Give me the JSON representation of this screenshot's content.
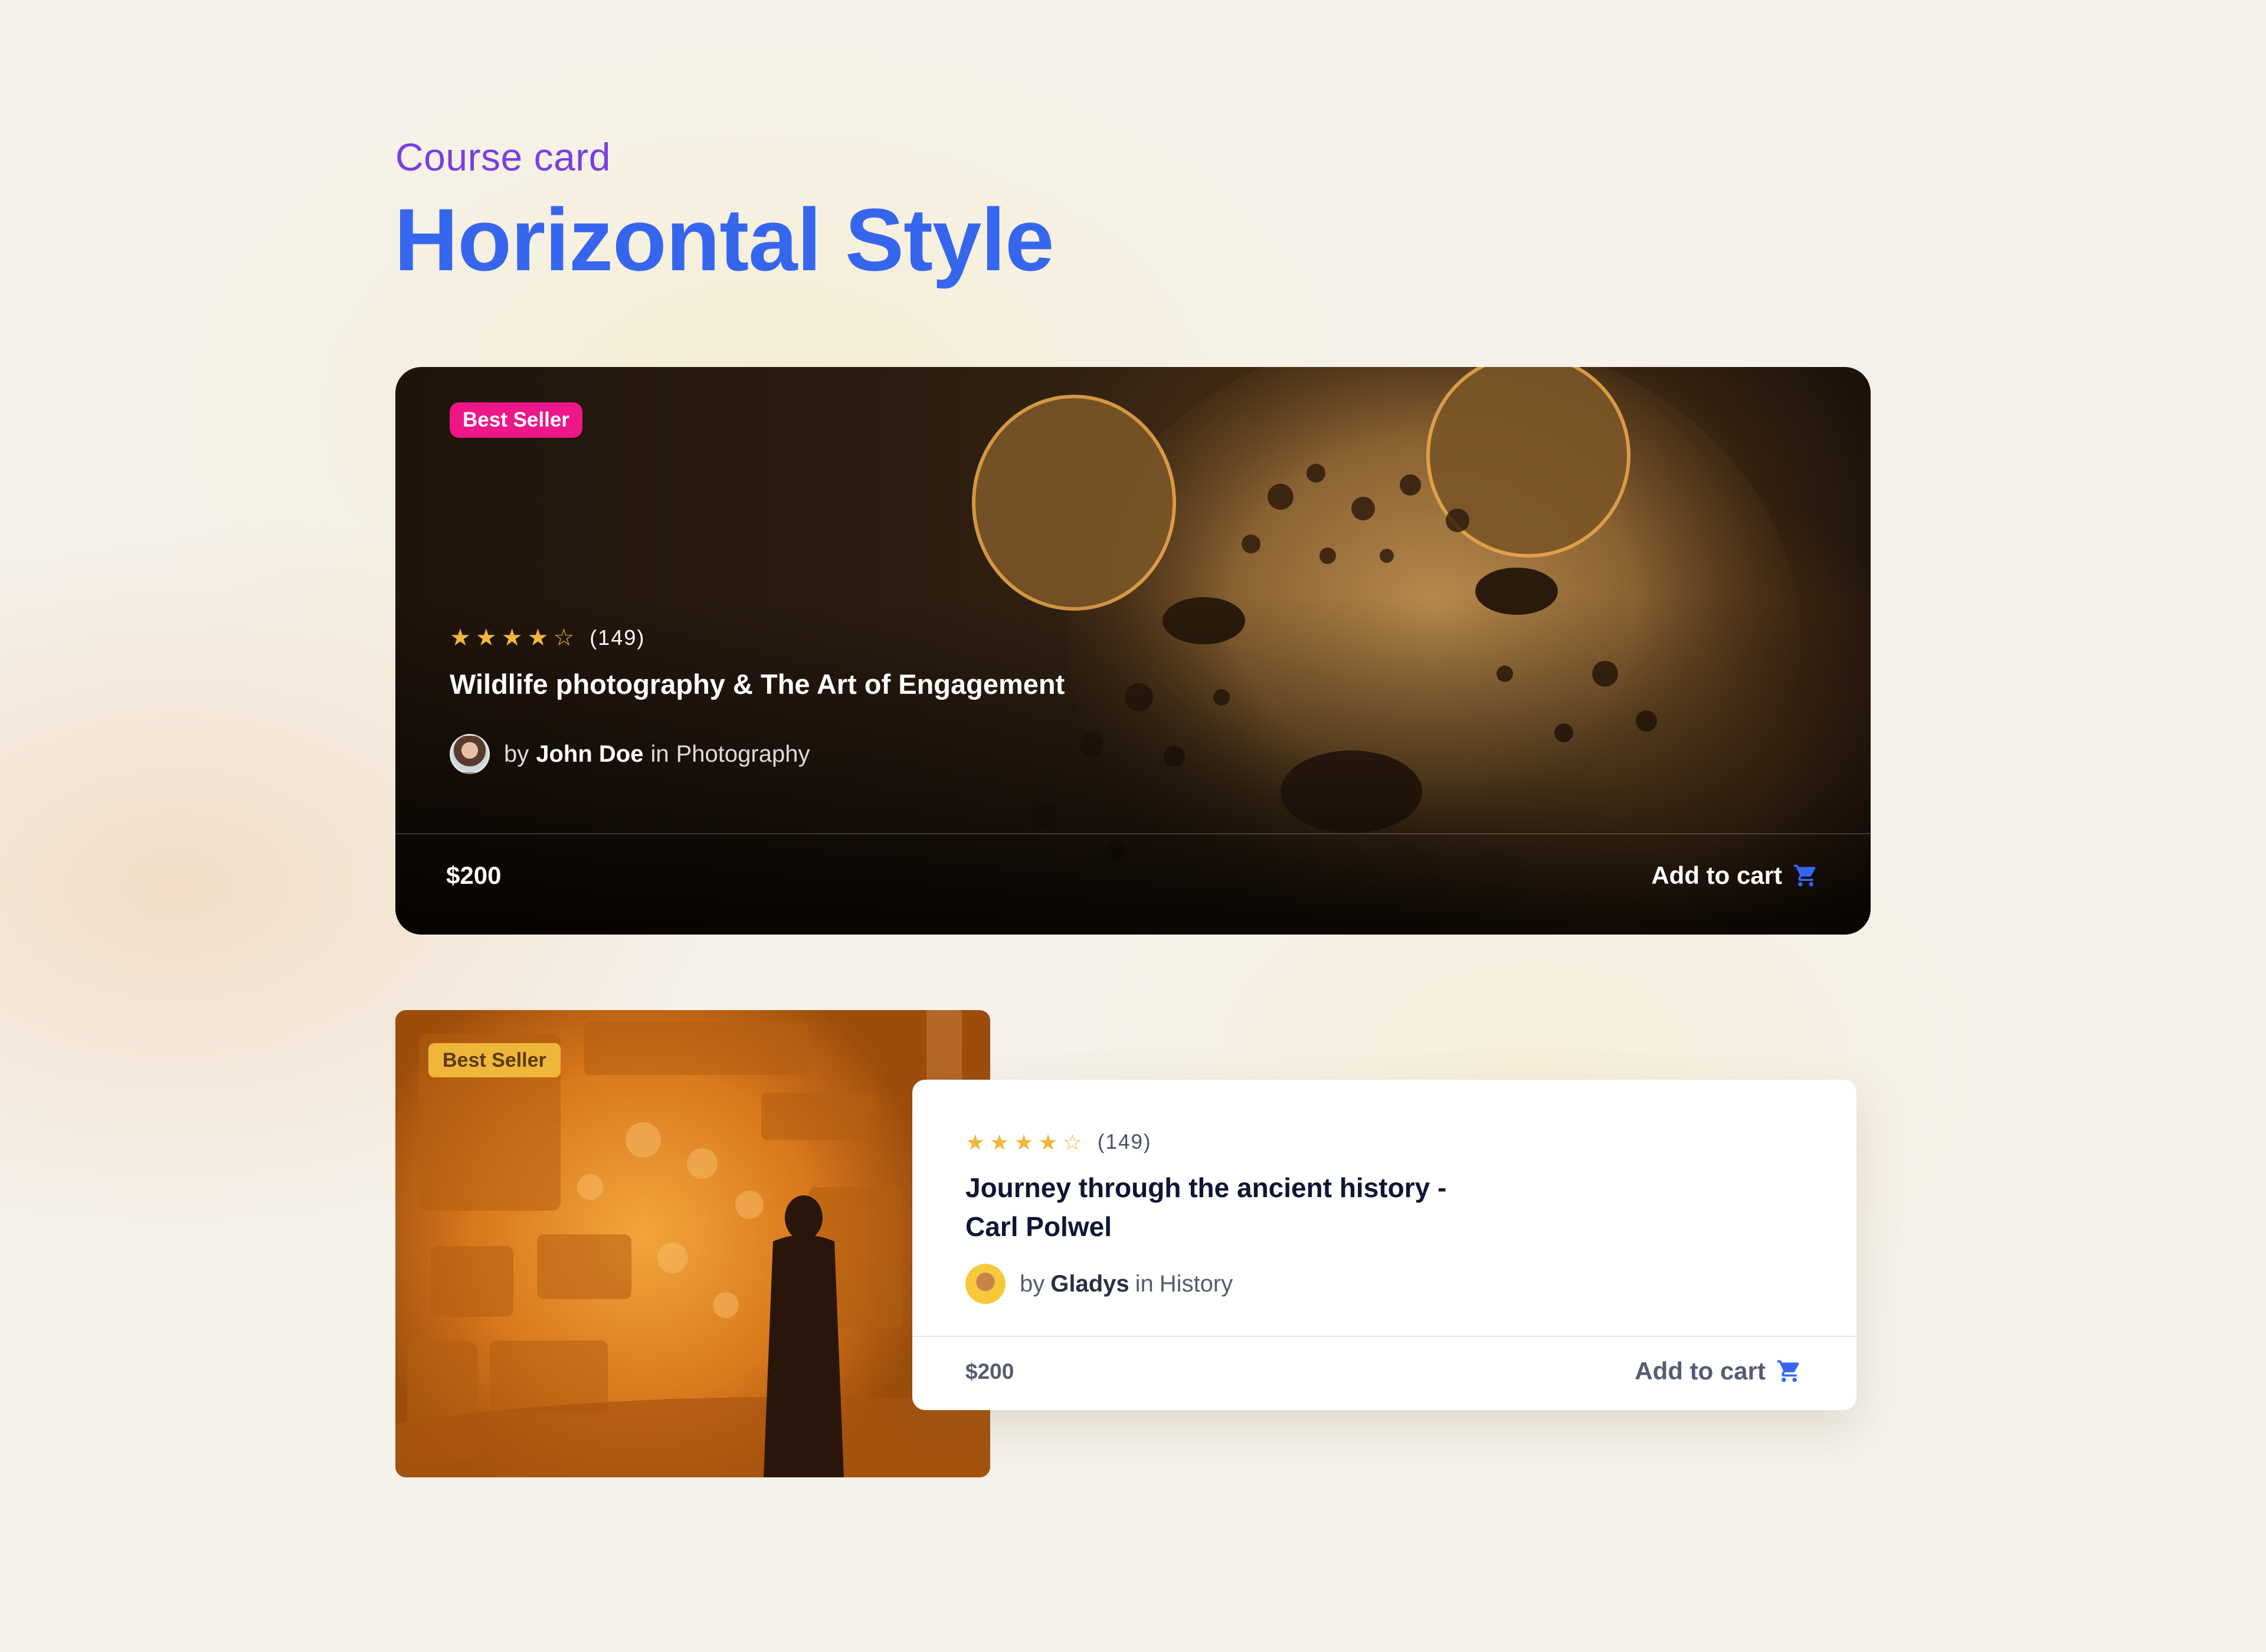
{
  "header": {
    "eyebrow": "Course card",
    "title": "Horizontal Style"
  },
  "card_dark": {
    "badge": "Best Seller",
    "rating": 4,
    "max_rating": 5,
    "rating_count": "(149)",
    "title": "Wildlife photography & The Art of Engagement",
    "by_label": "by",
    "author": "John Doe",
    "in_label": "in",
    "category": "Photography",
    "price": "$200",
    "cart_label": "Add to cart",
    "image": "leopard photo"
  },
  "card_light": {
    "badge": "Best Seller",
    "rating": 4,
    "max_rating": 5,
    "rating_count": "(149)",
    "title": "Journey through the ancient history - Carl Polwel",
    "by_label": "by",
    "author": "Gladys",
    "in_label": "in",
    "category": "History",
    "price": "$200",
    "cart_label": "Add to cart",
    "image": "ancient reliefs museum photo"
  },
  "colors": {
    "accent": "#3766ee",
    "eyebrow": "#7a3ee0",
    "badge_pink": "#ee1689",
    "badge_gold": "#f0b63a",
    "star": "#f3b53c"
  },
  "icons": {
    "star_full": "star-icon",
    "star_empty": "star-outline-icon",
    "cart": "cart-icon"
  }
}
